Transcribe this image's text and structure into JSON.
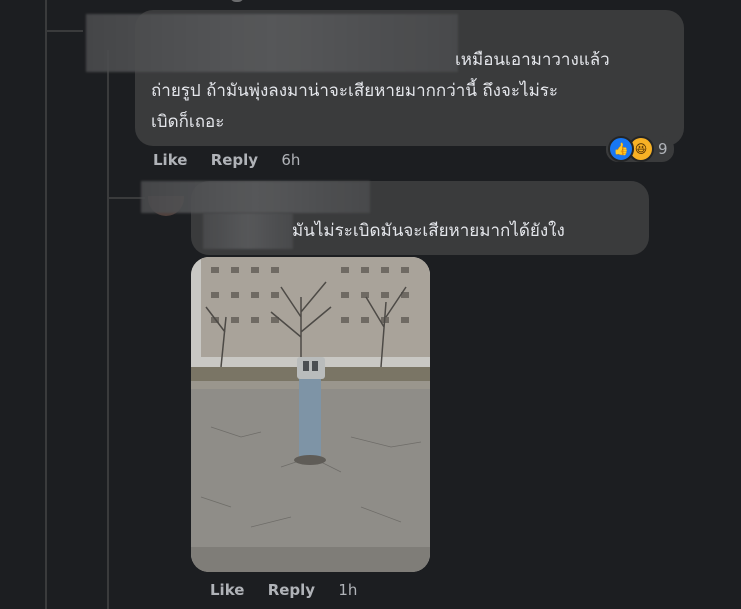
{
  "comment1": {
    "text_line1": "เหมือนเอามาวางแล้ว",
    "text_line2": "ถ่ายรูป ถ้ามันพุ่งลงมาน่าจะเสียหายมากกว่านี้ ถึงจะไม่ระ",
    "text_line3": "เบิดก็เถอะ",
    "reaction_count": "9",
    "actions": {
      "like": "Like",
      "reply": "Reply",
      "time": "6h"
    }
  },
  "comment2": {
    "text": "มันไม่ระเบิดมันจะเสียหายมากได้ยังใง",
    "actions": {
      "like": "Like",
      "reply": "Reply",
      "time": "1h"
    }
  }
}
